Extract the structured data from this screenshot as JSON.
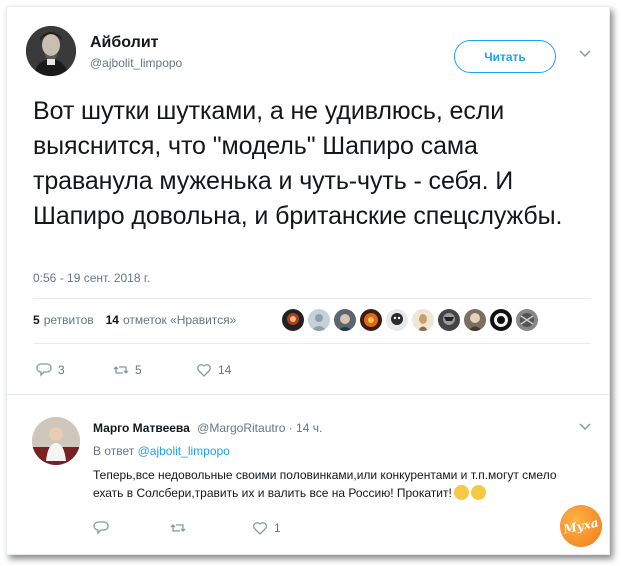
{
  "tweet": {
    "author_name": "Айболит",
    "author_handle": "@ajbolit_limpopo",
    "follow_label": "Читать",
    "text": "Вот шутки шутками, а не удивлюсь, если выяснится, что \"модель\" Шапиро сама травануla муженька и чуть-чуть - себя. И Шапиро довольна, и британские спецслужбы.",
    "timestamp": "0:56 - 19 сент. 2018 г.",
    "retweets_count": "5",
    "retweets_label": "ретвитов",
    "likes_count": "14",
    "likes_label": "отметок «Нравится»",
    "actions": {
      "reply_count": "3",
      "retweet_count": "5",
      "like_count": "14"
    }
  },
  "reply": {
    "author_name": "Марго Матвеева",
    "author_handle": "@MargoRitautro",
    "time": "· 14 ч.",
    "reply_to_prefix": "В ответ",
    "reply_to_handle": "@ajbolit_limpopo",
    "text": "Теперь,все недовольные своими половинками,или конкурентами и т.п.могут смело ехать в Солсбери,травить их и валить все на Россию! Прокатит!",
    "actions": {
      "reply_count": "",
      "retweet_count": "",
      "like_count": "1"
    }
  },
  "watermark": {
    "text": "Муха"
  },
  "colors": {
    "accent": "#1da1f2",
    "muted": "#657786",
    "text": "#14171a",
    "border": "#e6ecf0"
  },
  "icons": [
    "reply-icon",
    "retweet-icon",
    "heart-icon",
    "chevron-down-icon"
  ]
}
